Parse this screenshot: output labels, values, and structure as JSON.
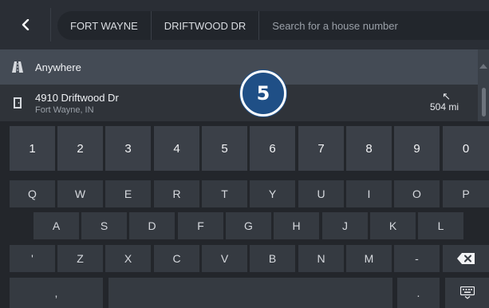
{
  "search": {
    "city": "FORT WAYNE",
    "street": "DRIFTWOOD DR",
    "placeholder": "Search for a house number"
  },
  "results": [
    {
      "title": "Anywhere",
      "icon": "road-icon"
    },
    {
      "title": "4910 Driftwood Dr",
      "subtitle": "Fort Wayne, IN",
      "distance": "504 mi",
      "direction_icon": "arrow-up-left-icon",
      "icon": "door-icon"
    }
  ],
  "badge": "5",
  "keyboard": {
    "numbers": [
      "1",
      "2",
      "3",
      "4",
      "5",
      "6",
      "7",
      "8",
      "9",
      "0"
    ],
    "row1": [
      "Q",
      "W",
      "E",
      "R",
      "T",
      "Y",
      "U",
      "I",
      "O",
      "P"
    ],
    "row2": [
      "A",
      "S",
      "D",
      "F",
      "G",
      "H",
      "J",
      "K",
      "L"
    ],
    "row3": [
      "'",
      "Z",
      "X",
      "C",
      "V",
      "B",
      "N",
      "M",
      "-"
    ],
    "row4_left": ",",
    "row4_right": ".",
    "backspace_icon": "backspace-icon",
    "hide_keyboard_icon": "keyboard-hide-icon"
  },
  "colors": {
    "background": "#1e2126",
    "badge": "#1f4f86",
    "selected_row": "#444b55"
  }
}
